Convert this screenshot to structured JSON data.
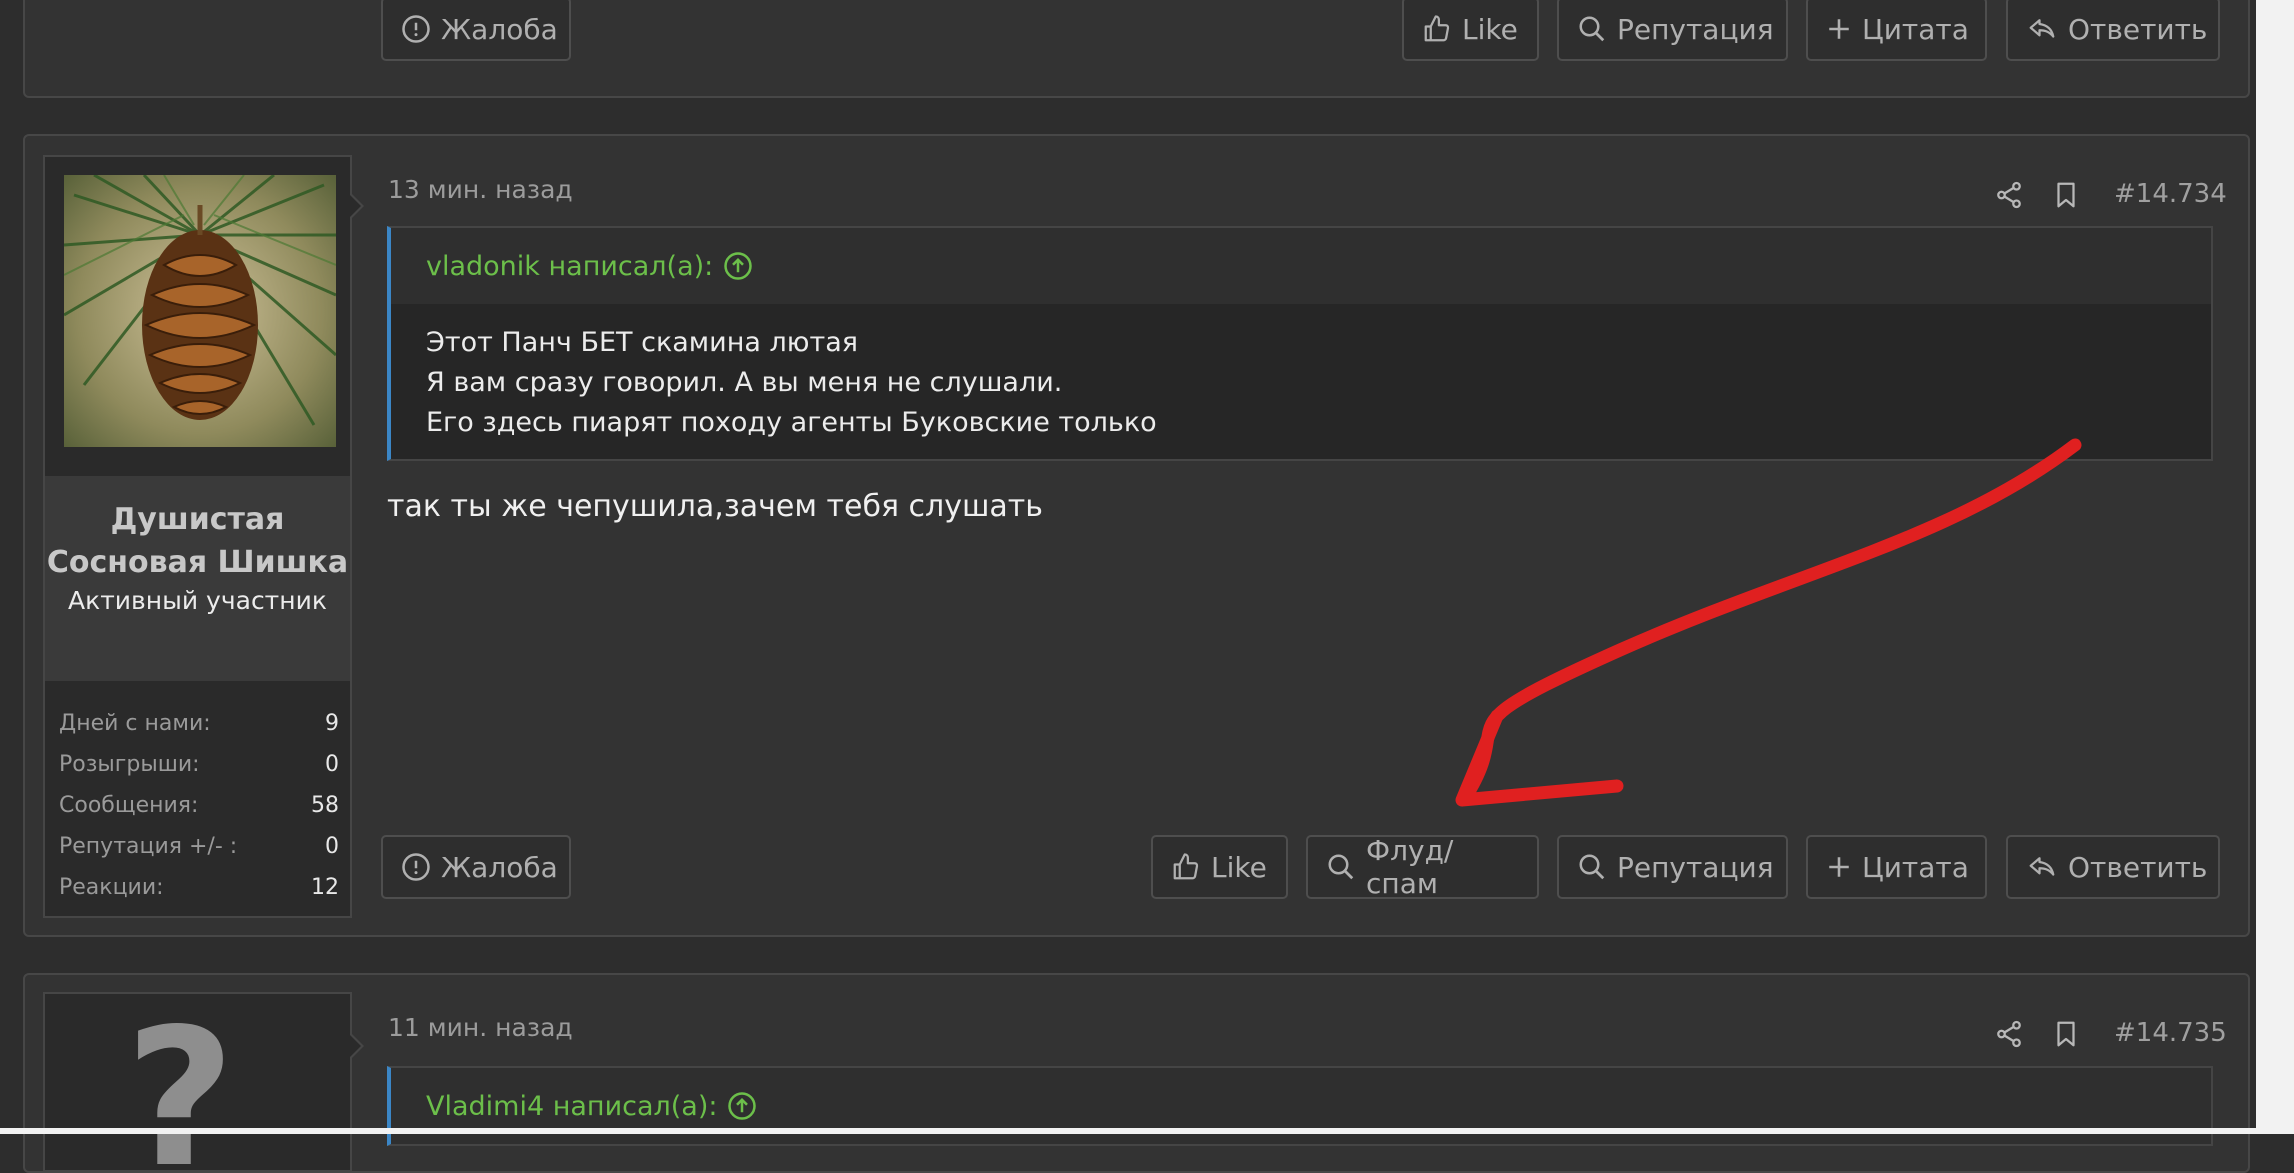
{
  "top_post": {
    "buttons": {
      "report": "Жалоба",
      "like": "Like",
      "reputation": "Репутация",
      "quote": "Цитата",
      "reply": "Ответить"
    }
  },
  "post1": {
    "user": {
      "avatar_icon": "pine-cone-photo",
      "name": "Душистая Сосновая Шишка",
      "title": "Активный участник",
      "stats": [
        {
          "label": "Дней с нами:",
          "value": "9"
        },
        {
          "label": "Розыгрыши:",
          "value": "0"
        },
        {
          "label": "Сообщения:",
          "value": "58"
        },
        {
          "label": "Репутация +/- :",
          "value": "0"
        },
        {
          "label": "Реакции:",
          "value": "12"
        }
      ]
    },
    "date": "13 мин. назад",
    "number": "#14.734",
    "quote": {
      "author": "vladonik написал(а):",
      "lines": [
        "Этот Панч БЕТ скамина лютая",
        "Я вам сразу говорил. А вы меня не слушали.",
        "Его здесь пиарят походу агенты Буковские только"
      ]
    },
    "message": "так ты же чепушила,зачем тебя слушать",
    "buttons": {
      "report": "Жалоба",
      "like": "Like",
      "flood": "Флуд/спам",
      "reputation": "Репутация",
      "quote": "Цитата",
      "reply": "Ответить"
    }
  },
  "post2": {
    "avatar_letter": "?",
    "date": "11 мин. назад",
    "number": "#14.735",
    "quote_author": "Vladimi4 написал(а):"
  },
  "colors": {
    "background": "#2d2d2d",
    "block": "#333333",
    "quote_author": "#6cbf4a",
    "quote_border": "#3b86c6",
    "annotation_arrow": "#e02020"
  }
}
